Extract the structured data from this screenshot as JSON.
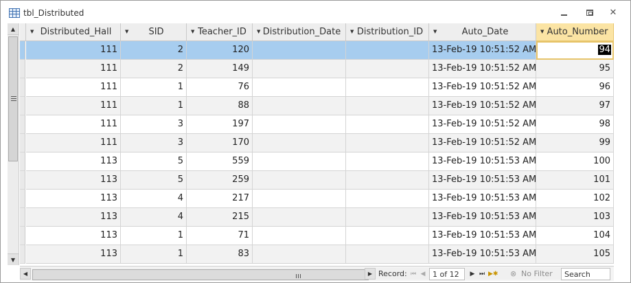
{
  "window": {
    "title": "tbl_Distributed"
  },
  "grid": {
    "columns": [
      {
        "label": "Distributed_Hall",
        "active": false
      },
      {
        "label": "SID",
        "active": false
      },
      {
        "label": "Teacher_ID",
        "active": false
      },
      {
        "label": "Distribution_Date",
        "active": false
      },
      {
        "label": "Distribution_ID",
        "active": false
      },
      {
        "label": "Auto_Date",
        "active": false
      },
      {
        "label": "Auto_Number",
        "active": true
      }
    ],
    "rows": [
      [
        "111",
        "2",
        "120",
        "",
        "",
        "13-Feb-19 10:51:52 AM",
        "94"
      ],
      [
        "111",
        "2",
        "149",
        "",
        "",
        "13-Feb-19 10:51:52 AM",
        "95"
      ],
      [
        "111",
        "1",
        "76",
        "",
        "",
        "13-Feb-19 10:51:52 AM",
        "96"
      ],
      [
        "111",
        "1",
        "88",
        "",
        "",
        "13-Feb-19 10:51:52 AM",
        "97"
      ],
      [
        "111",
        "3",
        "197",
        "",
        "",
        "13-Feb-19 10:51:52 AM",
        "98"
      ],
      [
        "111",
        "3",
        "170",
        "",
        "",
        "13-Feb-19 10:51:52 AM",
        "99"
      ],
      [
        "113",
        "5",
        "559",
        "",
        "",
        "13-Feb-19 10:51:53 AM",
        "100"
      ],
      [
        "113",
        "5",
        "259",
        "",
        "",
        "13-Feb-19 10:51:53 AM",
        "101"
      ],
      [
        "113",
        "4",
        "217",
        "",
        "",
        "13-Feb-19 10:51:53 AM",
        "102"
      ],
      [
        "113",
        "4",
        "215",
        "",
        "",
        "13-Feb-19 10:51:53 AM",
        "103"
      ],
      [
        "113",
        "1",
        "71",
        "",
        "",
        "13-Feb-19 10:51:53 AM",
        "104"
      ],
      [
        "113",
        "1",
        "83",
        "",
        "",
        "13-Feb-19 10:51:53 AM",
        "105"
      ]
    ]
  },
  "navigation": {
    "record_label": "Record:",
    "record_value": "1 of 12",
    "filter_label": "No Filter",
    "search_placeholder": "Search"
  },
  "colors": {
    "selected_row": "#a7cdef",
    "active_header": "#fbe4a4",
    "focus_border": "#e7c46a"
  }
}
